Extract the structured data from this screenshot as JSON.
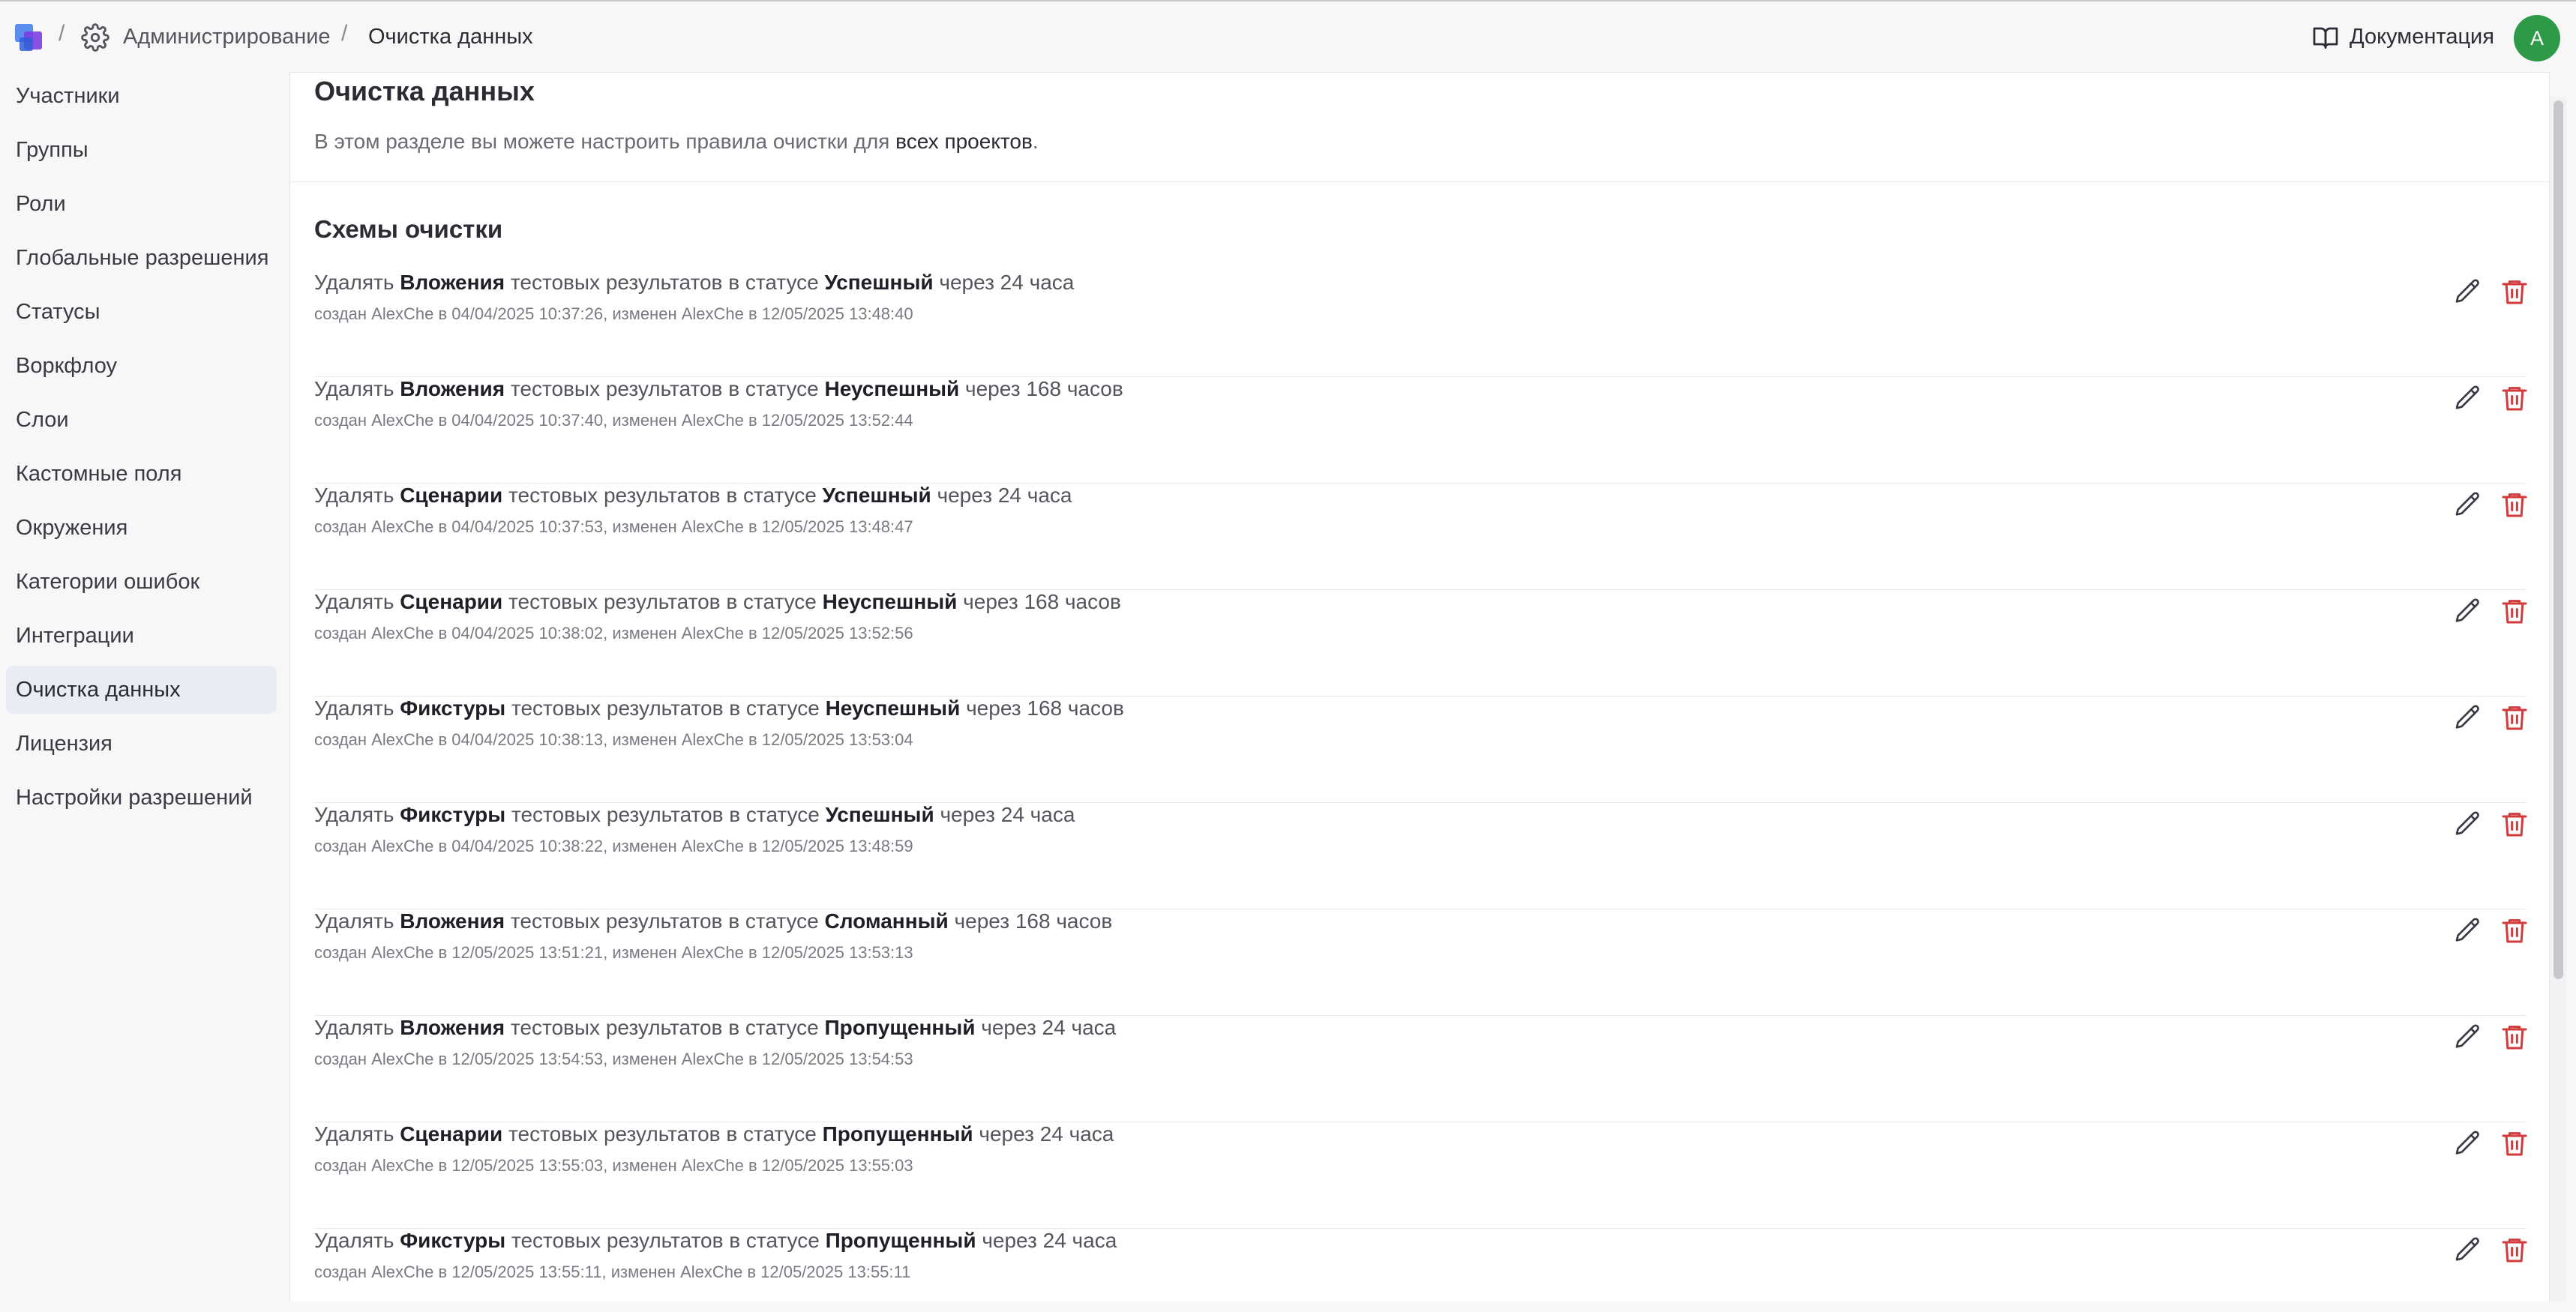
{
  "breadcrumb": {
    "separator": "/",
    "admin": "Администрирование",
    "current": "Очистка данных"
  },
  "header": {
    "docs_label": "Документация",
    "avatar_initial": "A",
    "avatar_color": "#2e9a47"
  },
  "sidebar": {
    "items": [
      {
        "label": "Участники"
      },
      {
        "label": "Группы"
      },
      {
        "label": "Роли"
      },
      {
        "label": "Глобальные разрешения"
      },
      {
        "label": "Статусы"
      },
      {
        "label": "Воркфлоу"
      },
      {
        "label": "Слои"
      },
      {
        "label": "Кастомные поля"
      },
      {
        "label": "Окружения"
      },
      {
        "label": "Категории ошибок"
      },
      {
        "label": "Интеграции"
      },
      {
        "label": "Очистка данных",
        "active": true
      },
      {
        "label": "Лицензия"
      },
      {
        "label": "Настройки разрешений"
      }
    ]
  },
  "page": {
    "title": "Очистка данных",
    "desc_prefix": "В этом разделе вы можете настроить правила очистки для ",
    "desc_bold": "всех проектов",
    "desc_suffix": ".",
    "section_title": "Схемы очистки"
  },
  "rules": [
    {
      "p1": "Удалять ",
      "type": "Вложения",
      "p2": " тестовых результатов в статусе ",
      "status": "Успешный",
      "p3": " через 24 часа",
      "meta": "создан AlexChe в 04/04/2025 10:37:26, изменен AlexChe в 12/05/2025 13:48:40"
    },
    {
      "p1": "Удалять ",
      "type": "Вложения",
      "p2": " тестовых результатов в статусе ",
      "status": "Неуспешный",
      "p3": " через 168 часов",
      "meta": "создан AlexChe в 04/04/2025 10:37:40, изменен AlexChe в 12/05/2025 13:52:44"
    },
    {
      "p1": "Удалять ",
      "type": "Сценарии",
      "p2": " тестовых результатов в статусе ",
      "status": "Успешный",
      "p3": " через 24 часа",
      "meta": "создан AlexChe в 04/04/2025 10:37:53, изменен AlexChe в 12/05/2025 13:48:47"
    },
    {
      "p1": "Удалять ",
      "type": "Сценарии",
      "p2": " тестовых результатов в статусе ",
      "status": "Неуспешный",
      "p3": " через 168 часов",
      "meta": "создан AlexChe в 04/04/2025 10:38:02, изменен AlexChe в 12/05/2025 13:52:56"
    },
    {
      "p1": "Удалять ",
      "type": "Фикстуры",
      "p2": " тестовых результатов в статусе ",
      "status": "Неуспешный",
      "p3": " через 168 часов",
      "meta": "создан AlexChe в 04/04/2025 10:38:13, изменен AlexChe в 12/05/2025 13:53:04"
    },
    {
      "p1": "Удалять ",
      "type": "Фикстуры",
      "p2": " тестовых результатов в статусе ",
      "status": "Успешный",
      "p3": " через 24 часа",
      "meta": "создан AlexChe в 04/04/2025 10:38:22, изменен AlexChe в 12/05/2025 13:48:59"
    },
    {
      "p1": "Удалять ",
      "type": "Вложения",
      "p2": " тестовых результатов в статусе ",
      "status": "Сломанный",
      "p3": " через 168 часов",
      "meta": "создан AlexChe в 12/05/2025 13:51:21, изменен AlexChe в 12/05/2025 13:53:13"
    },
    {
      "p1": "Удалять ",
      "type": "Вложения",
      "p2": " тестовых результатов в статусе ",
      "status": "Пропущенный",
      "p3": " через 24 часа",
      "meta": "создан AlexChe в 12/05/2025 13:54:53, изменен AlexChe в 12/05/2025 13:54:53"
    },
    {
      "p1": "Удалять ",
      "type": "Сценарии",
      "p2": " тестовых результатов в статусе ",
      "status": "Пропущенный",
      "p3": " через 24 часа",
      "meta": "создан AlexChe в 12/05/2025 13:55:03, изменен AlexChe в 12/05/2025 13:55:03"
    },
    {
      "p1": "Удалять ",
      "type": "Фикстуры",
      "p2": " тестовых результатов в статусе ",
      "status": "Пропущенный",
      "p3": " через 24 часа",
      "meta": "создан AlexChe в 12/05/2025 13:55:11, изменен AlexChe в 12/05/2025 13:55:11"
    }
  ],
  "colors": {
    "delete_icon": "#d13b3b",
    "edit_icon": "#3a3a44",
    "active_sidebar_bg": "#e9ecf4"
  },
  "icons": {
    "logo": "app-logo-icon",
    "settings": "gear-icon",
    "docs": "book-icon",
    "edit": "pencil-icon",
    "delete": "trash-icon"
  }
}
